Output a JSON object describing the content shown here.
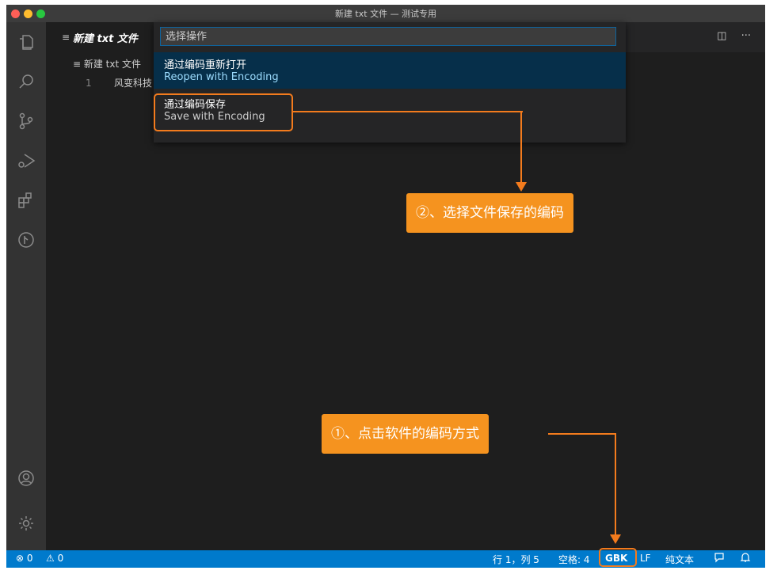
{
  "window": {
    "title": "新建 txt 文件 — 测试专用",
    "traffic_colors": [
      "#fe5f57",
      "#febc2e",
      "#28c840"
    ]
  },
  "activity_bar": {
    "items": [
      "explorer-icon",
      "search-icon",
      "source-control-icon",
      "run-debug-icon",
      "extensions-icon",
      "timeline-icon"
    ],
    "bottom": [
      "account-icon",
      "settings-gear-icon"
    ]
  },
  "tab": {
    "icon": "≡",
    "label": "新建 txt 文件"
  },
  "tab_actions": {
    "split": "◫",
    "more": "···"
  },
  "breadcrumb": "≡ 新建 txt 文件",
  "editor": {
    "line_number": "1",
    "line_text": "风变科技"
  },
  "quick_pick": {
    "placeholder": "选择操作",
    "items": [
      {
        "title": "通过编码重新打开",
        "subtitle": "Reopen with Encoding"
      },
      {
        "title": "通过编码保存",
        "subtitle": "Save with Encoding"
      }
    ]
  },
  "status_bar": {
    "errors": "⊗ 0",
    "warnings": "⚠ 0",
    "position": "行 1，列 5",
    "spaces": "空格: 4",
    "encoding": "GBK",
    "eol": "LF",
    "language": "纯文本",
    "feedback_icon": "feedback-icon",
    "bell_icon": "bell-icon"
  },
  "annotations": {
    "step1": "①、点击软件的编码方式",
    "step2": "②、选择文件保存的编码",
    "color": "#f37b1d"
  }
}
